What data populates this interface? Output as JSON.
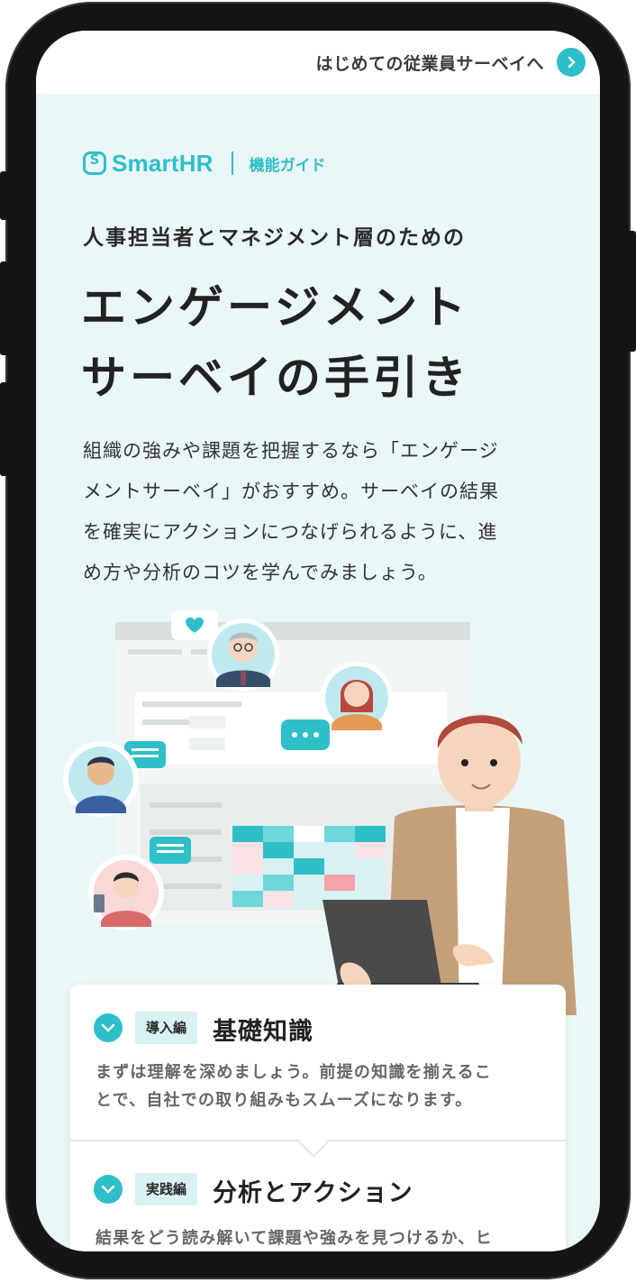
{
  "header": {
    "survey_link": "はじめての従業員サーベイへ",
    "arrow_icon": "chevron-right-icon"
  },
  "brand": {
    "logo_glyph": "S",
    "logo": "SmartHR",
    "guide_label": "機能ガイド"
  },
  "hero": {
    "eyebrow": "人事担当者とマネジメント層のための",
    "title_line1": "エンゲージメント",
    "title_line2": "サーベイの手引き",
    "desc_lines": [
      "組織の強みや課題を把握するなら「エンゲージ",
      "メントサーベイ」がおすすめ。サーベイの結果",
      "を確実にアクションにつなげられるように、進",
      "め方や分析のコツを学んでみましょう。"
    ]
  },
  "sections": [
    {
      "tag": "導入編",
      "heading": "基礎知識",
      "body_lines": [
        "まずは理解を深めましょう。前提の知識を揃えるこ",
        "とで、自社での取り組みもスムーズになります。"
      ]
    },
    {
      "tag": "実践編",
      "heading": "分析とアクション",
      "body_lines": [
        "結果をどう読み解いて課題や強みを見つけるか、ヒ"
      ]
    }
  ],
  "colors": {
    "accent": "#2fbfc9",
    "background": "#eaf7f8",
    "text": "#222222"
  }
}
